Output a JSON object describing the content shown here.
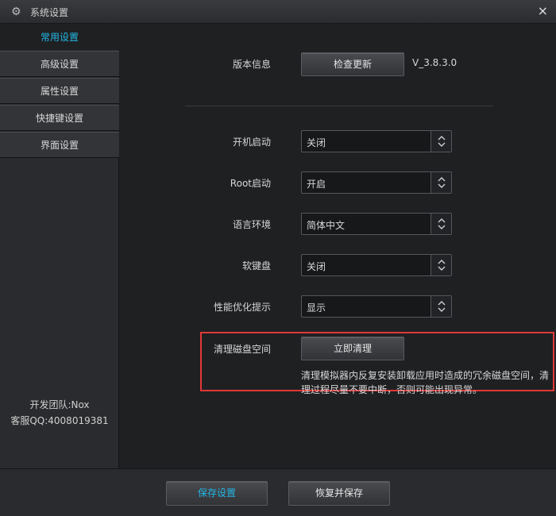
{
  "window": {
    "title": "系统设置",
    "gear_icon": "gear-icon",
    "close_glyph": "×"
  },
  "sidebar": {
    "items": [
      {
        "label": "常用设置",
        "active": true
      },
      {
        "label": "高级设置",
        "active": false
      },
      {
        "label": "属性设置",
        "active": false
      },
      {
        "label": "快捷键设置",
        "active": false
      },
      {
        "label": "界面设置",
        "active": false
      }
    ],
    "footer": {
      "team": "开发团队:Nox",
      "qq": "客服QQ:4008019381"
    }
  },
  "main": {
    "version": {
      "label": "版本信息",
      "button": "检查更新",
      "value": "V_3.8.3.0"
    },
    "settings": [
      {
        "label": "开机启动",
        "value": "关闭"
      },
      {
        "label": "Root启动",
        "value": "开启"
      },
      {
        "label": "语言环境",
        "value": "简体中文"
      },
      {
        "label": "软键盘",
        "value": "关闭"
      },
      {
        "label": "性能优化提示",
        "value": "显示"
      }
    ],
    "cleanup": {
      "label": "清理磁盘空间",
      "button": "立即清理",
      "description": "清理模拟器内反复安装卸载应用时造成的冗余磁盘空间，清理过程尽量不要中断，否则可能出现异常。"
    }
  },
  "footer": {
    "save_button": "保存设置",
    "restore_button": "恢复并保存"
  },
  "colors": {
    "accent": "#22b7e6",
    "highlight": "#e03838",
    "background": "#1f2022"
  }
}
